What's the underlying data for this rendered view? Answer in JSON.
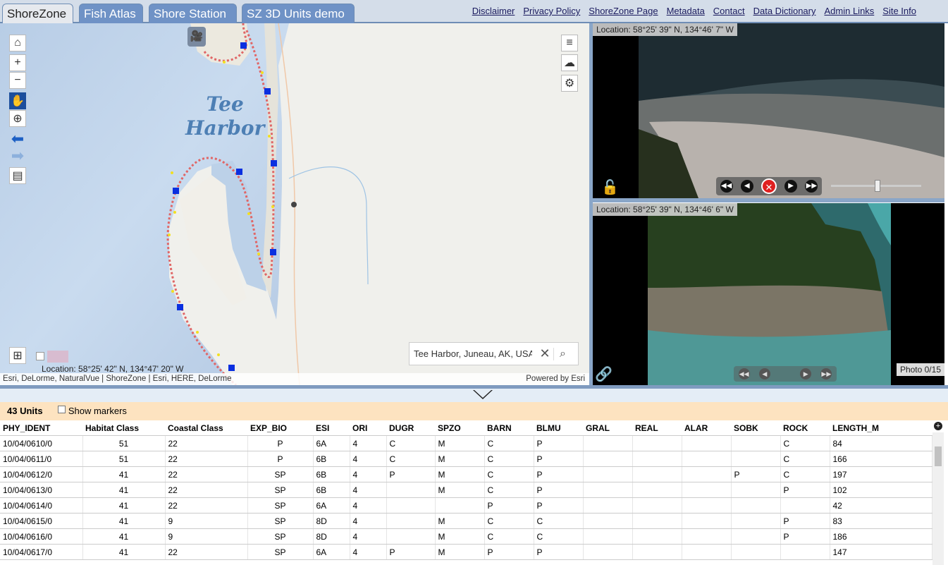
{
  "tabs": [
    {
      "label": "ShoreZone"
    },
    {
      "label": "Fish Atlas"
    },
    {
      "label": "Shore Station"
    },
    {
      "label": "SZ 3D Units demo"
    }
  ],
  "links": [
    "Disclaimer",
    "Privacy Policy",
    "ShoreZone Page",
    "Metadata",
    "Contact",
    "Data Dictionary",
    "Admin Links",
    "Site Info"
  ],
  "map": {
    "place_label_1": "Tee",
    "place_label_2": "Harbor",
    "location": "Location: 58°25' 42\" N, 134°47' 20\" W",
    "attribution_left": "Esri, DeLorme, NaturalVue | ShoreZone | Esri, HERE, DeLorme",
    "attribution_right": "Powered by Esri",
    "search_value": "Tee Harbor, Juneau, AK, USA"
  },
  "video": {
    "location": "Location: 58°25' 39\" N, 134°46' 7\" W"
  },
  "photo": {
    "location": "Location: 58°25' 39\" N, 134°46' 6\" W",
    "counter": "Photo 0/15"
  },
  "units": {
    "count_label": "43 Units",
    "markers_label": "Show markers"
  },
  "table": {
    "headers": [
      "PHY_IDENT",
      "Habitat Class",
      "Coastal Class",
      "EXP_BIO",
      "ESI",
      "ORI",
      "DUGR",
      "SPZO",
      "BARN",
      "BLMU",
      "GRAL",
      "REAL",
      "ALAR",
      "SOBK",
      "ROCK",
      "LENGTH_M"
    ],
    "rows": [
      [
        "10/04/0610/0",
        "51",
        "22",
        "P",
        "6A",
        "4",
        "C",
        "M",
        "C",
        "P",
        "",
        "",
        "",
        "",
        "C",
        "84"
      ],
      [
        "10/04/0611/0",
        "51",
        "22",
        "P",
        "6B",
        "4",
        "C",
        "M",
        "C",
        "P",
        "",
        "",
        "",
        "",
        "C",
        "166"
      ],
      [
        "10/04/0612/0",
        "41",
        "22",
        "SP",
        "6B",
        "4",
        "P",
        "M",
        "C",
        "P",
        "",
        "",
        "",
        "P",
        "C",
        "197"
      ],
      [
        "10/04/0613/0",
        "41",
        "22",
        "SP",
        "6B",
        "4",
        "",
        "M",
        "C",
        "P",
        "",
        "",
        "",
        "",
        "P",
        "102"
      ],
      [
        "10/04/0614/0",
        "41",
        "22",
        "SP",
        "6A",
        "4",
        "",
        "",
        "P",
        "P",
        "",
        "",
        "",
        "",
        "",
        "42"
      ],
      [
        "10/04/0615/0",
        "41",
        "9",
        "SP",
        "8D",
        "4",
        "",
        "M",
        "C",
        "C",
        "",
        "",
        "",
        "",
        "P",
        "83"
      ],
      [
        "10/04/0616/0",
        "41",
        "9",
        "SP",
        "8D",
        "4",
        "",
        "M",
        "C",
        "C",
        "",
        "",
        "",
        "",
        "P",
        "186"
      ],
      [
        "10/04/0617/0",
        "41",
        "22",
        "SP",
        "6A",
        "4",
        "P",
        "M",
        "P",
        "P",
        "",
        "",
        "",
        "",
        "",
        "147"
      ]
    ]
  }
}
